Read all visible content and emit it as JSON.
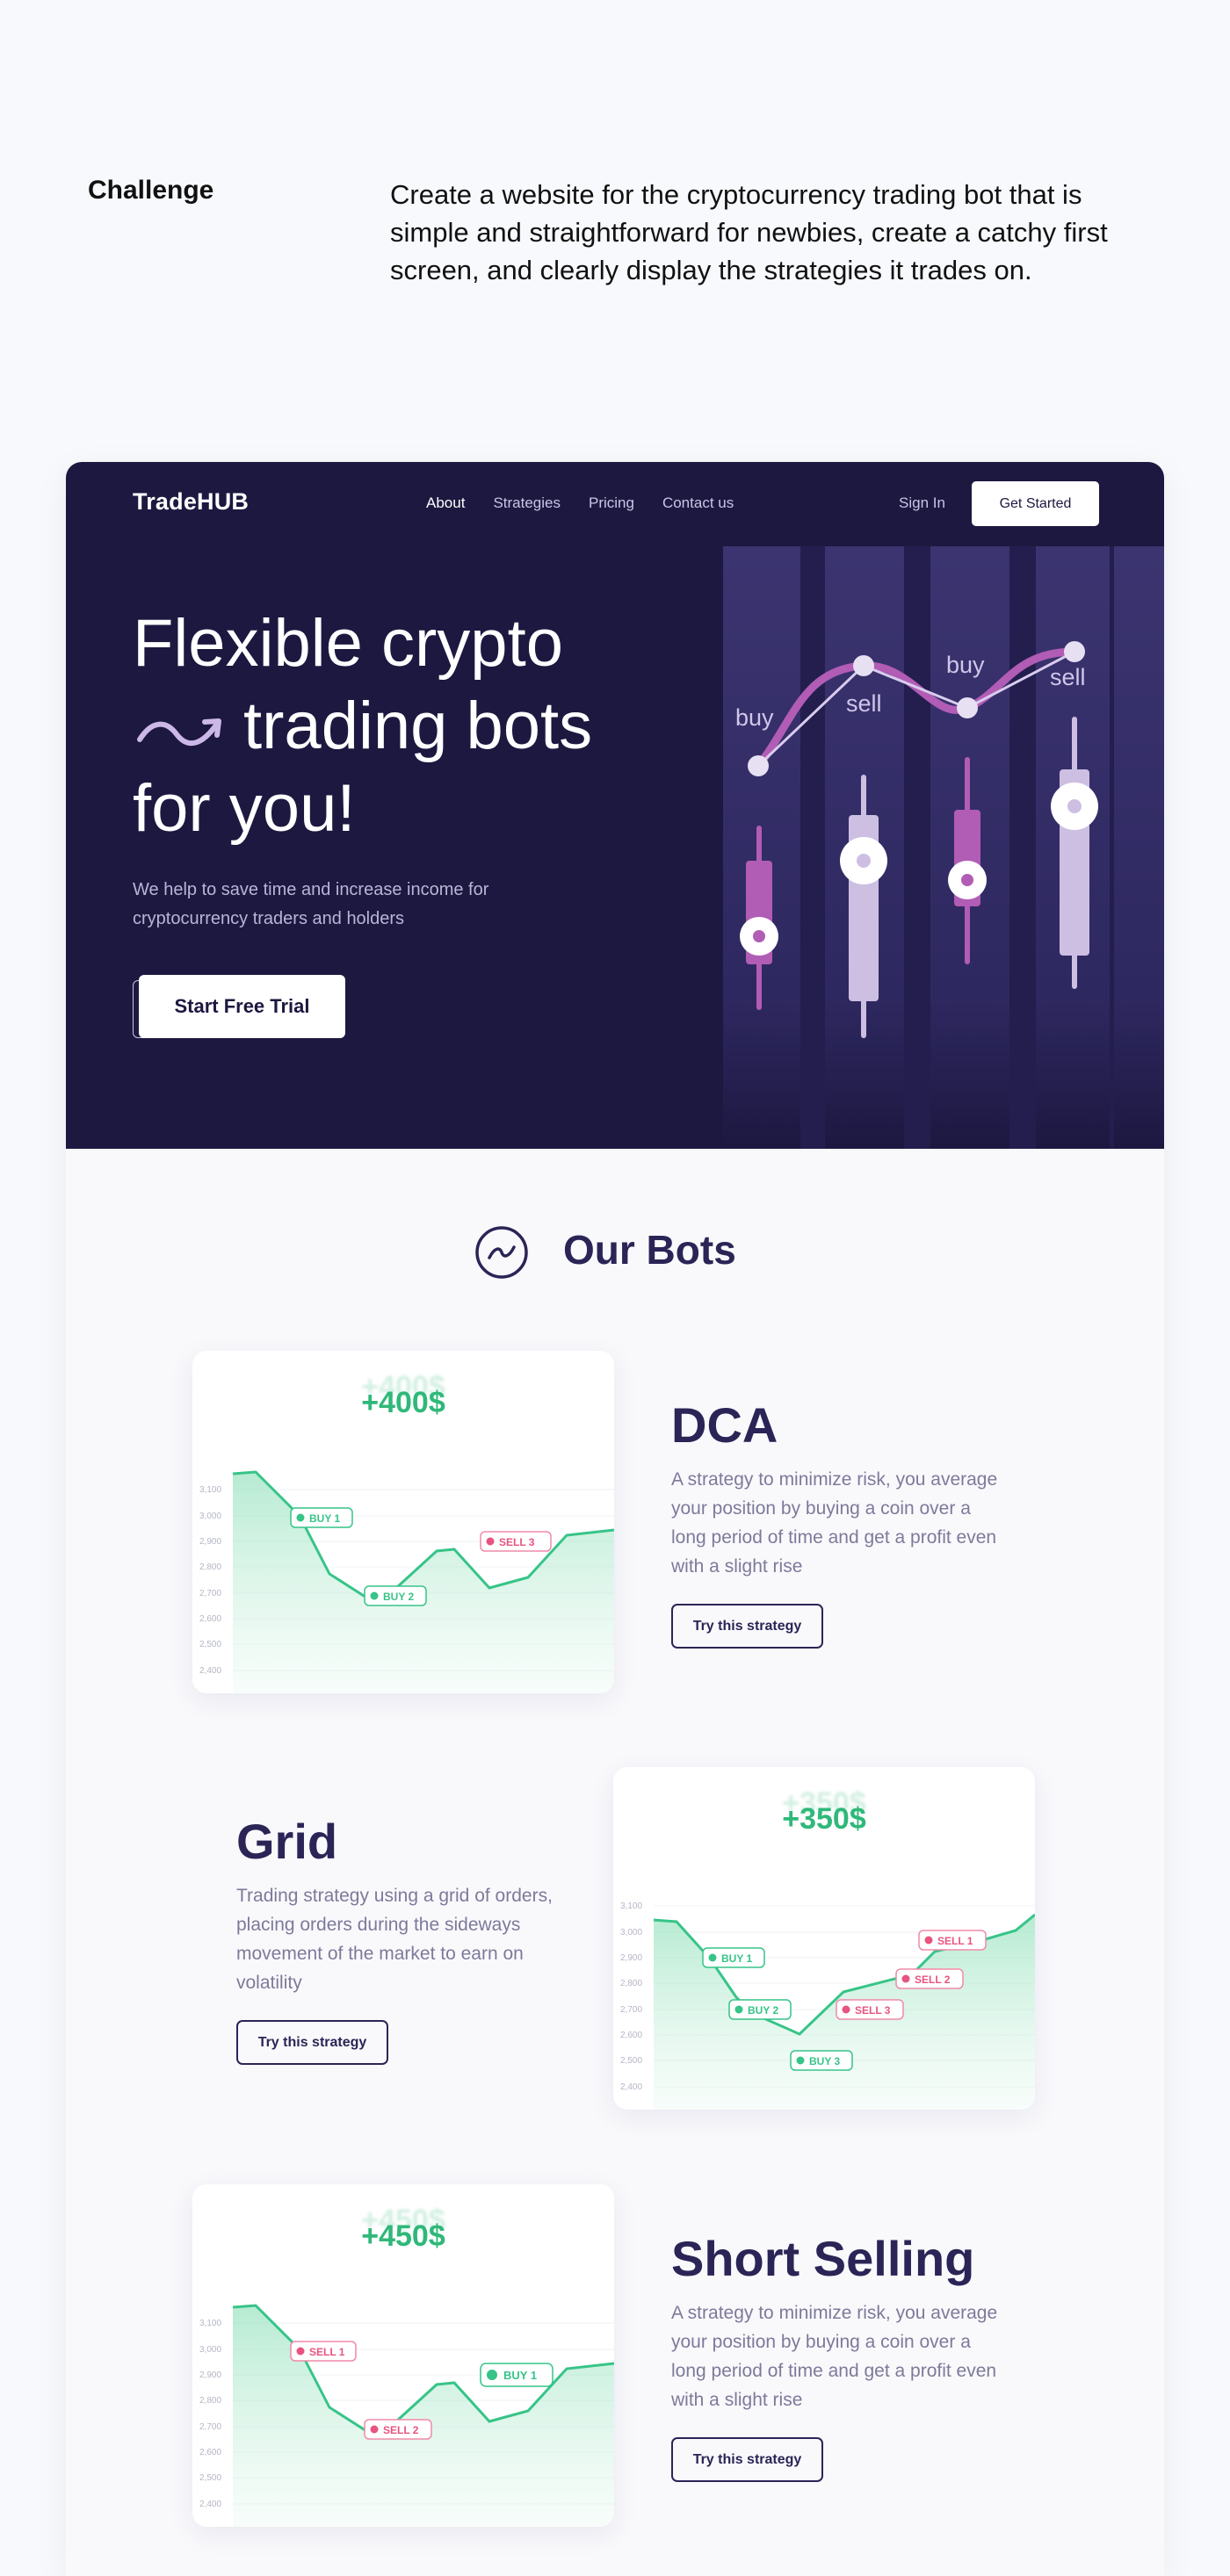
{
  "challenge": {
    "label": "Challenge",
    "text": "Create a website for the cryptocurrency trading bot that is simple and straightforward for newbies, create a catchy first screen, and clearly display the strategies it trades on."
  },
  "nav": {
    "logo": "TradeHUB",
    "links": [
      "About",
      "Strategies",
      "Pricing",
      "Contact us"
    ],
    "sign_in": "Sign In",
    "get_started": "Get Started"
  },
  "hero": {
    "title_line1": "Flexible crypto",
    "title_line2": "trading bots",
    "title_line3": "for you!",
    "subtitle": "We help to save time and increase income for cryptocurrency traders and holders",
    "cta": "Start Free Trial",
    "art_labels": [
      "buy",
      "sell",
      "buy",
      "sell"
    ]
  },
  "bots": {
    "heading": "Our Bots",
    "strategies": [
      {
        "name": "DCA",
        "description": "A strategy to minimize risk, you average your position by buying a coin over a long period of time and get a profit even with a slight rise",
        "button": "Try this strategy",
        "profit": "+400$",
        "y_ticks": [
          "3,100",
          "3,000",
          "2,900",
          "2,800",
          "2,700",
          "2,600",
          "2,500",
          "2,400"
        ],
        "markers": [
          "BUY 1",
          "BUY 2",
          "SELL 3"
        ]
      },
      {
        "name": "Grid",
        "description": "Trading strategy using a grid of orders, placing orders during the sideways movement of the market to earn on volatility",
        "button": "Try this strategy",
        "profit": "+350$",
        "y_ticks": [
          "3,100",
          "3,000",
          "2,900",
          "2,800",
          "2,700",
          "2,600",
          "2,500",
          "2,400"
        ],
        "markers": [
          "BUY 1",
          "BUY 2",
          "BUY 3",
          "SELL 3",
          "SELL 2",
          "SELL 1"
        ]
      },
      {
        "name": "Short Selling",
        "description": "A strategy to minimize risk, you average your position by buying a coin over a long period of time and get a profit even with a slight rise",
        "button": "Try this strategy",
        "profit": "+450$",
        "y_ticks": [
          "3,100",
          "3,000",
          "2,900",
          "2,800",
          "2,700",
          "2,600",
          "2,500",
          "2,400"
        ],
        "markers": [
          "SELL 1",
          "SELL 2",
          "BUY 1"
        ]
      }
    ]
  },
  "colors": {
    "hero_bg": "#1c1840",
    "accent_green": "#2fb879",
    "accent_pink": "#e8547f",
    "accent_purple": "#b15cb5",
    "text_dark": "#2a2556"
  }
}
